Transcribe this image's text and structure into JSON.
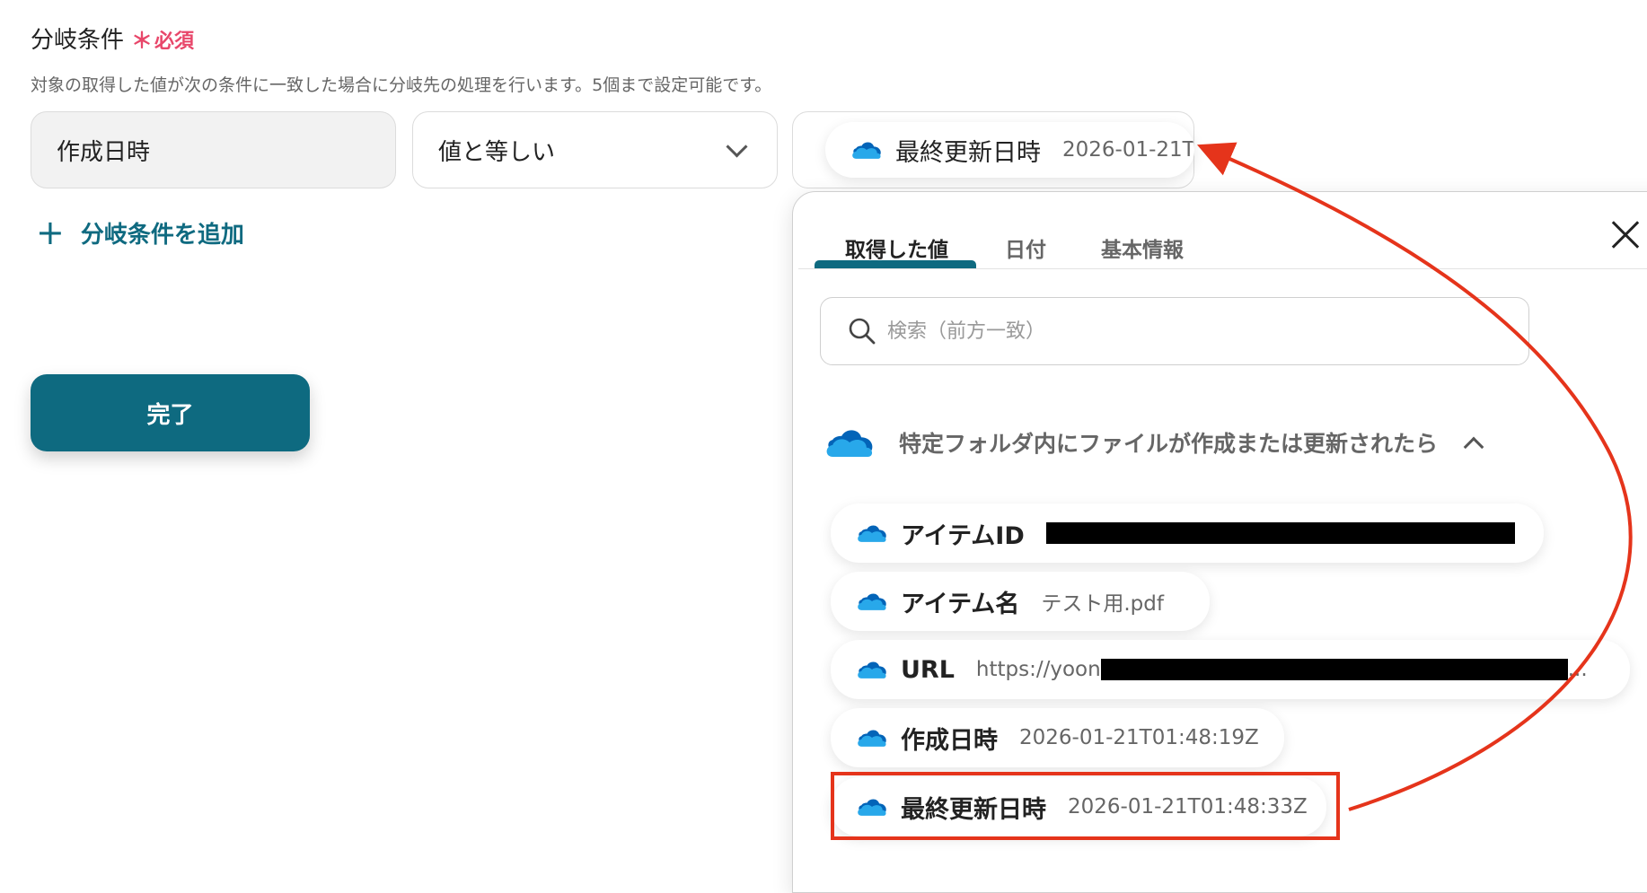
{
  "section": {
    "title": "分岐条件",
    "required_mark": "＊",
    "required_text": "必須",
    "description": "対象の取得した値が次の条件に一致した場合に分岐先の処理を行います。5個まで設定可能です。"
  },
  "condition": {
    "field": "作成日時",
    "operator": "値と等しい",
    "value_key": "最終更新日時",
    "value_text": "2026-01-21T"
  },
  "add_condition_label": "分岐条件を追加",
  "done_label": "完了",
  "panel": {
    "tabs": [
      "取得した値",
      "日付",
      "基本情報"
    ],
    "active_tab": "取得した値",
    "search_placeholder": "検索（前方一致）",
    "group_title": "特定フォルダ内にファイルが作成または更新されたら",
    "items": [
      {
        "key": "アイテムID",
        "value": ""
      },
      {
        "key": "アイテム名",
        "value": "テスト用.pdf"
      },
      {
        "key": "URL",
        "value": "https://yoon",
        "value_suffix": "..."
      },
      {
        "key": "作成日時",
        "value": "2026-01-21T01:48:19Z"
      },
      {
        "key": "最終更新日時",
        "value": "2026-01-21T01:48:33Z"
      }
    ]
  },
  "colors": {
    "accent": "#0e6a80",
    "required": "#e8476a",
    "annotation": "#e5341b",
    "onedrive_dark": "#0364b8",
    "onedrive_light": "#28a8ea"
  },
  "icons": [
    "onedrive-cloud-icon",
    "chevron-down-icon",
    "chevron-up-icon",
    "close-icon",
    "search-icon",
    "plus-icon"
  ]
}
